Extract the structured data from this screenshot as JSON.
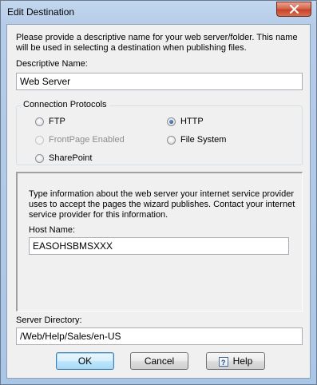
{
  "window": {
    "title": "Edit Destination"
  },
  "intro_text": "Please provide a descriptive name for your web server/folder. This name will be used in selecting a destination when publishing files.",
  "descriptive_name": {
    "label": "Descriptive Name:",
    "value": "Web Server"
  },
  "protocols": {
    "title": "Connection Protocols",
    "options": [
      {
        "label": "FTP",
        "checked": false,
        "enabled": true
      },
      {
        "label": "HTTP",
        "checked": true,
        "enabled": true
      },
      {
        "label": "FrontPage Enabled",
        "checked": false,
        "enabled": false
      },
      {
        "label": "File System",
        "checked": false,
        "enabled": true
      },
      {
        "label": "SharePoint",
        "checked": false,
        "enabled": true
      }
    ]
  },
  "http_panel": {
    "info_text": "Type information about the web server your internet service provider uses to accept the pages the wizard publishes. Contact your internet service provider for this information.",
    "host_label": "Host Name:",
    "host_value": "EASOHSBMSXXX"
  },
  "server_directory": {
    "label": "Server Directory:",
    "value": "/Web/Help/Sales/en-US"
  },
  "buttons": {
    "ok": "OK",
    "cancel": "Cancel",
    "help": "Help",
    "help_icon_glyph": "?"
  },
  "colors": {
    "accent": "#3c7fb1",
    "close_button": "#c54328",
    "dialog_face": "#f0f0f0"
  },
  "icons": {
    "close": "close-icon",
    "help": "help-icon"
  }
}
